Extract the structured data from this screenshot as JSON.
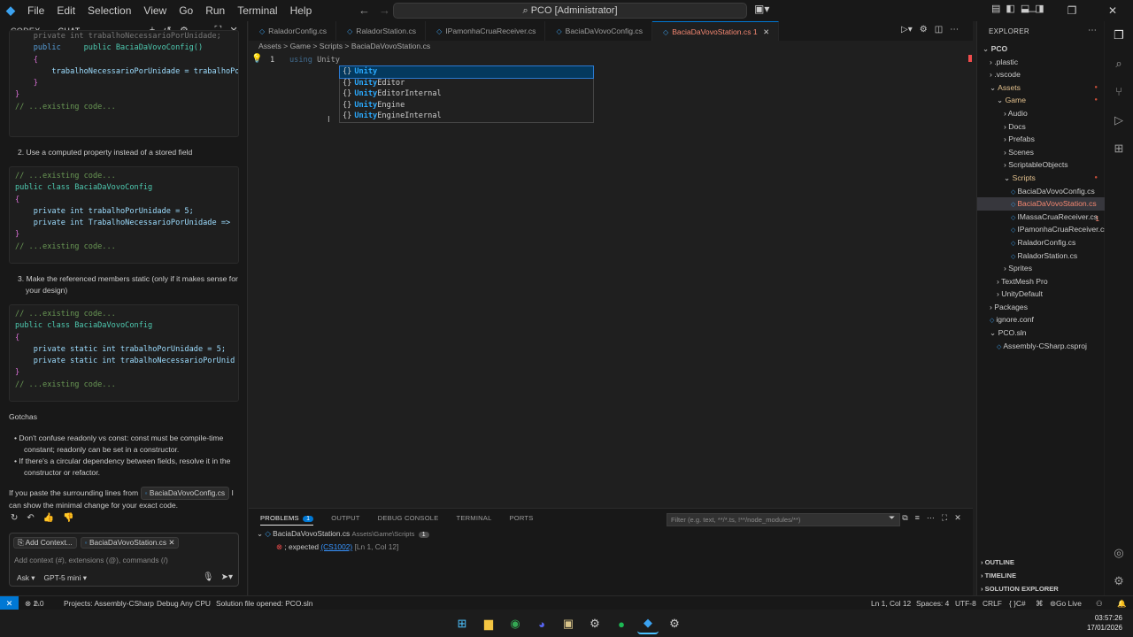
{
  "titlebar": {
    "menu": [
      "File",
      "Edit",
      "Selection",
      "View",
      "Go",
      "Run",
      "Terminal",
      "Help"
    ],
    "command_center": "PCO [Administrator]"
  },
  "chat": {
    "tab_codex": "CODEX",
    "tab_chat": "CHAT",
    "block1": [
      "    private int trabalhoNecessarioPorUnidade;",
      "    public BaciaDaVovoConfig()",
      "    {",
      "        trabalhoNecessarioPorUnidade = trabalhoPo",
      "    }",
      "}",
      "// ...existing code..."
    ],
    "step2": "2. Use a computed property instead of a stored field",
    "block2": [
      "// ...existing code...",
      "public class BaciaDaVovoConfig",
      "{",
      "    private int trabalhoPorUnidade = 5;",
      "    private int TrabalhoNecessarioPorUnidade =>",
      "}",
      "// ...existing code..."
    ],
    "step3a": "3. Make the referenced members static (only if it makes sense for",
    "step3b": "your design)",
    "block3": [
      "// ...existing code...",
      "public class BaciaDaVovoConfig",
      "{",
      "    private static int trabalhoPorUnidade = 5;",
      "    private static int trabalhoNecessarioPorUnid",
      "}",
      "// ...existing code..."
    ],
    "gotchas_title": "Gotchas",
    "gotcha1a": "Don't confuse readonly vs const: const must be compile-time",
    "gotcha1b": "constant; readonly can be set in a constructor.",
    "gotcha2a": "If there's a circular dependency between fields, resolve it in the",
    "gotcha2b": "constructor or refactor.",
    "closing_a": "If you paste the surrounding lines from",
    "closing_chip": "BaciaDaVovoConfig.cs",
    "closing_b": "I",
    "closing_c": "can show the minimal change for your exact code.",
    "add_context": "Add Context...",
    "context_file": "BaciaDaVovoStation.cs",
    "input_placeholder": "Add context (#), extensions (@), commands (/)",
    "mode": "Ask",
    "model": "GPT-5 mini"
  },
  "editor": {
    "tabs": [
      {
        "label": "RaladorConfig.cs",
        "active": false
      },
      {
        "label": "RaladorStation.cs",
        "active": false
      },
      {
        "label": "IPamonhaCruaReceiver.cs",
        "active": false
      },
      {
        "label": "BaciaDaVovoConfig.cs",
        "active": false
      },
      {
        "label": "BaciaDaVovoStation.cs 1",
        "active": true
      }
    ],
    "breadcrumb": "Assets > Game > Scripts > BaciaDaVovoStation.cs",
    "line_number": "1",
    "code_kw": "using",
    "code_text": "Unity",
    "suggestions": [
      {
        "match": "Unity",
        "rest": ""
      },
      {
        "match": "Unity",
        "rest": "Editor"
      },
      {
        "match": "Unity",
        "rest": "EditorInternal"
      },
      {
        "match": "Unity",
        "rest": "Engine"
      },
      {
        "match": "Unity",
        "rest": "EngineInternal"
      }
    ]
  },
  "panel": {
    "tabs": [
      "PROBLEMS",
      "OUTPUT",
      "DEBUG CONSOLE",
      "TERMINAL",
      "PORTS"
    ],
    "problems_count": "1",
    "filter_placeholder": "Filter (e.g. text, **/*.ts, !**/node_modules/**)",
    "file": "BaciaDaVovoStation.cs",
    "file_path": "Assets\\Game\\Scripts",
    "file_count": "1",
    "error_msg": "; expected",
    "error_code": "(CS1002)",
    "error_loc": "[Ln 1, Col 12]"
  },
  "explorer": {
    "title": "EXPLORER",
    "items": [
      {
        "label": "PCO",
        "indent": 0,
        "kind": "root"
      },
      {
        "label": ".plastic",
        "indent": 1,
        "kind": "folder"
      },
      {
        "label": ".vscode",
        "indent": 1,
        "kind": "folder"
      },
      {
        "label": "Assets",
        "indent": 1,
        "kind": "open-mod"
      },
      {
        "label": "Game",
        "indent": 2,
        "kind": "open-mod"
      },
      {
        "label": "Audio",
        "indent": 3,
        "kind": "folder"
      },
      {
        "label": "Docs",
        "indent": 3,
        "kind": "folder"
      },
      {
        "label": "Prefabs",
        "indent": 3,
        "kind": "folder"
      },
      {
        "label": "Scenes",
        "indent": 3,
        "kind": "folder"
      },
      {
        "label": "ScriptableObjects",
        "indent": 3,
        "kind": "folder"
      },
      {
        "label": "Scripts",
        "indent": 3,
        "kind": "open-mod"
      },
      {
        "label": "BaciaDaVovoConfig.cs",
        "indent": 4,
        "kind": "file"
      },
      {
        "label": "BaciaDaVovoStation.cs",
        "indent": 4,
        "kind": "file-sel",
        "badge": "1"
      },
      {
        "label": "IMassaCruaReceiver.cs",
        "indent": 4,
        "kind": "file"
      },
      {
        "label": "IPamonhaCruaReceiver.cs",
        "indent": 4,
        "kind": "file"
      },
      {
        "label": "RaladorConfig.cs",
        "indent": 4,
        "kind": "file"
      },
      {
        "label": "RaladorStation.cs",
        "indent": 4,
        "kind": "file"
      },
      {
        "label": "Sprites",
        "indent": 3,
        "kind": "folder"
      },
      {
        "label": "TextMesh Pro",
        "indent": 2,
        "kind": "folder"
      },
      {
        "label": "UnityDefault",
        "indent": 2,
        "kind": "folder"
      },
      {
        "label": "Packages",
        "indent": 1,
        "kind": "folder"
      },
      {
        "label": "ignore.conf",
        "indent": 1,
        "kind": "plain"
      },
      {
        "label": "PCO.sln",
        "indent": 1,
        "kind": "open"
      },
      {
        "label": "Assembly-CSharp.csproj",
        "indent": 2,
        "kind": "plain"
      }
    ],
    "outline": "OUTLINE",
    "timeline": "TIMELINE",
    "solution": "SOLUTION EXPLORER"
  },
  "statusbar": {
    "errors": "1",
    "warnings": "0",
    "project": "Projects: Assembly-CSharp",
    "config": "Debug Any CPU",
    "message": "Solution file opened: PCO.sln",
    "position": "Ln 1, Col 12",
    "spaces": "Spaces: 4",
    "encoding": "UTF-8",
    "eol": "CRLF",
    "language": "C#",
    "golive": "Go Live"
  },
  "taskbar": {
    "time": "03:57:26",
    "date": "17/01/2026"
  },
  "colors": {
    "accent": "#0078d4",
    "error": "#f48771",
    "modified": "#e2c08d"
  }
}
